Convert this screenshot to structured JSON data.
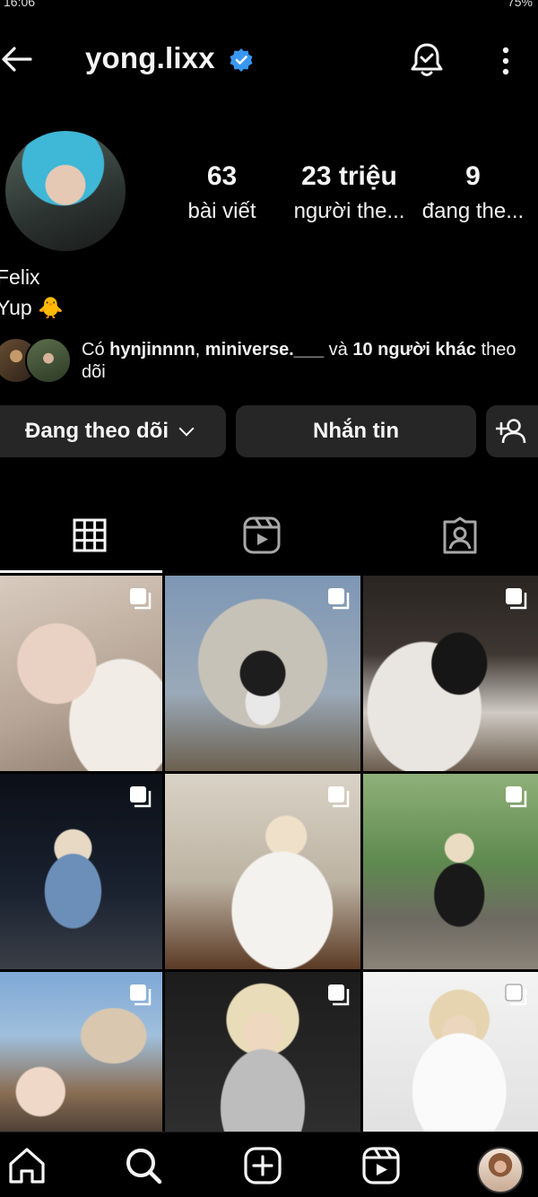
{
  "status_bar": {
    "left": "16:06",
    "right": "75%"
  },
  "header": {
    "username": "yong.lixx"
  },
  "profile": {
    "stats": [
      {
        "value": "63",
        "label": "bài viết"
      },
      {
        "value": "23 triệu",
        "label": "người the..."
      },
      {
        "value": "9",
        "label": "đang the..."
      }
    ],
    "full_name": "Felix",
    "bio": "Yup 🐥"
  },
  "followed_by": {
    "prefix": "Có ",
    "name1": "hynjinnnn",
    "sep": ", ",
    "name2": "miniverse.___",
    "mid": " và ",
    "others": "10 người khác",
    "suffix": " theo dõi"
  },
  "buttons": {
    "following": "Đang theo dõi",
    "message": "Nhắn tin"
  },
  "colors": {
    "background": "#000000",
    "button": "#262626",
    "verified": "#3897f0"
  },
  "icons": {
    "back": "back-arrow-icon",
    "verified": "verified-badge-icon",
    "bell": "notification-bell-icon",
    "more": "more-vertical-icon",
    "suggest": "add-person-icon",
    "grid": "grid-icon",
    "reels": "reels-icon",
    "tagged": "tagged-icon",
    "home": "home-icon",
    "search": "search-icon",
    "create": "create-icon"
  }
}
